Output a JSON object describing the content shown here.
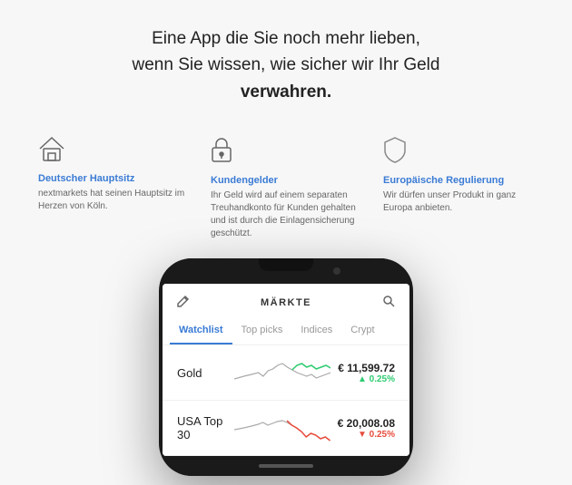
{
  "hero": {
    "line1": "Eine App die Sie noch mehr lieben,",
    "line2": "wenn Sie wissen, wie sicher wir Ihr Geld",
    "line3": "verwahren."
  },
  "features": [
    {
      "id": "hauptsitz",
      "icon": "🏠",
      "title": "Deutscher Hauptsitz",
      "desc": "nextmarkets hat seinen Hauptsitz im Herzen von Köln."
    },
    {
      "id": "kundengelder",
      "icon": "🔒",
      "title": "Kundengelder",
      "desc": "Ihr Geld wird auf einem separaten Treuhandkonto für Kunden gehalten und ist durch die Einlagensicherung geschützt."
    },
    {
      "id": "regulierung",
      "icon": "🛡",
      "title": "Europäische Regulierung",
      "desc": "Wir dürfen unser Produkt in ganz Europa anbieten."
    }
  ],
  "app": {
    "header_title": "MÄRKTE",
    "tabs": [
      {
        "label": "Watchlist",
        "active": true
      },
      {
        "label": "Top picks",
        "active": false
      },
      {
        "label": "Indices",
        "active": false
      },
      {
        "label": "Crypt",
        "active": false
      }
    ],
    "stocks": [
      {
        "name": "Gold",
        "price": "€ 11,599.72",
        "change": "▲ 0.25%",
        "trend": "up",
        "chart_color": "#2ecc71"
      },
      {
        "name": "USA Top 30",
        "price": "€ 20,008.08",
        "change": "▼ 0.25%",
        "trend": "down",
        "chart_color": "#e74c3c"
      }
    ]
  }
}
